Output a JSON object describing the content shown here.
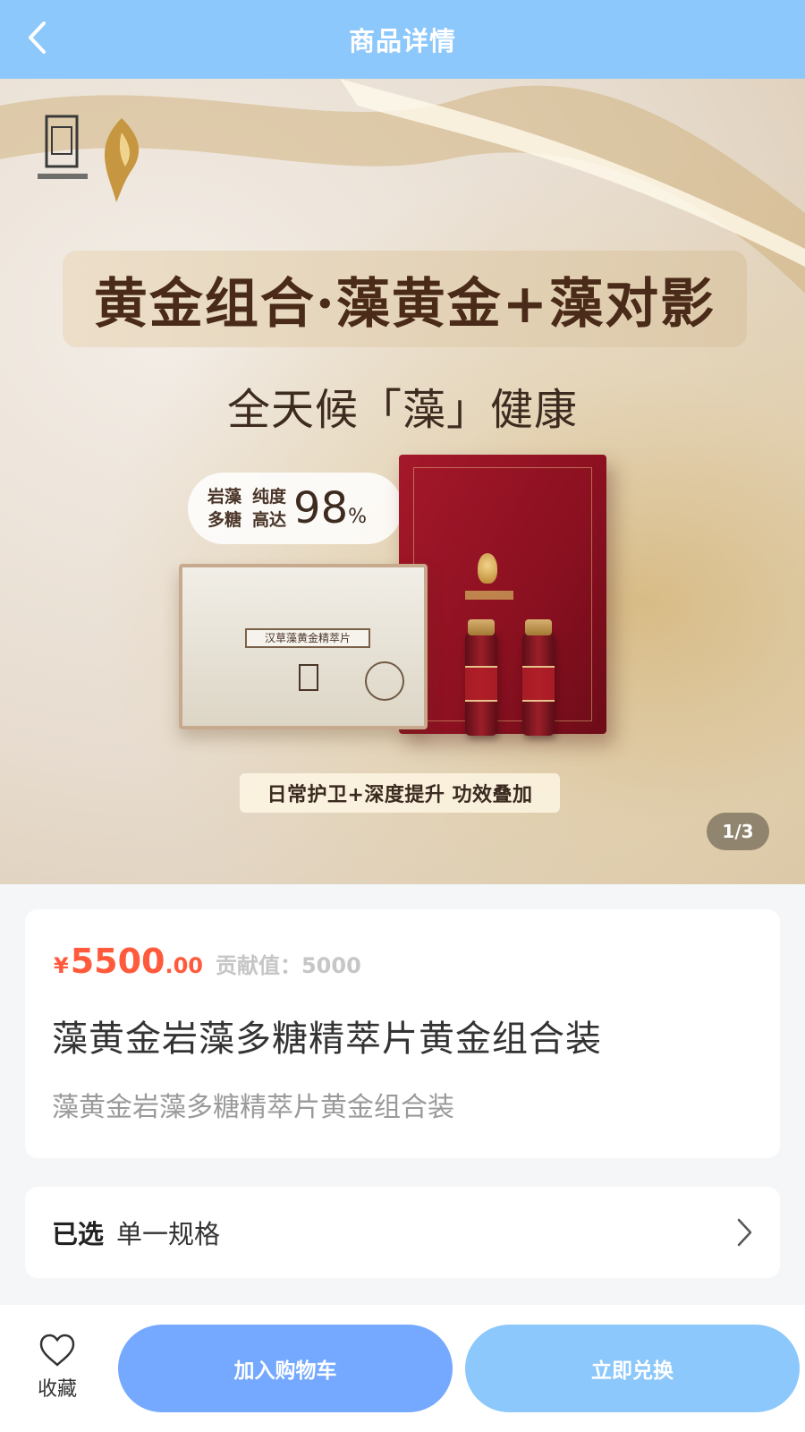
{
  "header": {
    "title": "商品详情",
    "back_icon": "chevron-left-icon",
    "background": "#8cc8fb"
  },
  "banner": {
    "headline": "黄金组合·藻黄金+藻对影",
    "subhead": "全天候「藻」健康",
    "purity_line1a": "岩藻",
    "purity_line1b": "多糖",
    "purity_line2a": "纯度",
    "purity_line2b": "高达",
    "purity_value": "98",
    "purity_unit": "%",
    "box_label": "汉草藻黄金精萃片",
    "tagline": "日常护卫+深度提升 功效叠加",
    "page_indicator": "1/3"
  },
  "product": {
    "currency": "¥",
    "price_main": "5500",
    "price_cents": ".00",
    "contribution": "贡献值：5000",
    "title": "藻黄金岩藻多糖精萃片黄金组合装",
    "subtitle": "藻黄金岩藻多糖精萃片黄金组合装",
    "price_color": "#ff5a3c"
  },
  "spec": {
    "label": "已选",
    "value": "单一规格"
  },
  "bottom_bar": {
    "favorite_label": "收藏",
    "add_to_cart_label": "加入购物车",
    "redeem_label": "立即兑换",
    "cart_color": "#75a9ff",
    "redeem_color": "#8cc8fb"
  }
}
